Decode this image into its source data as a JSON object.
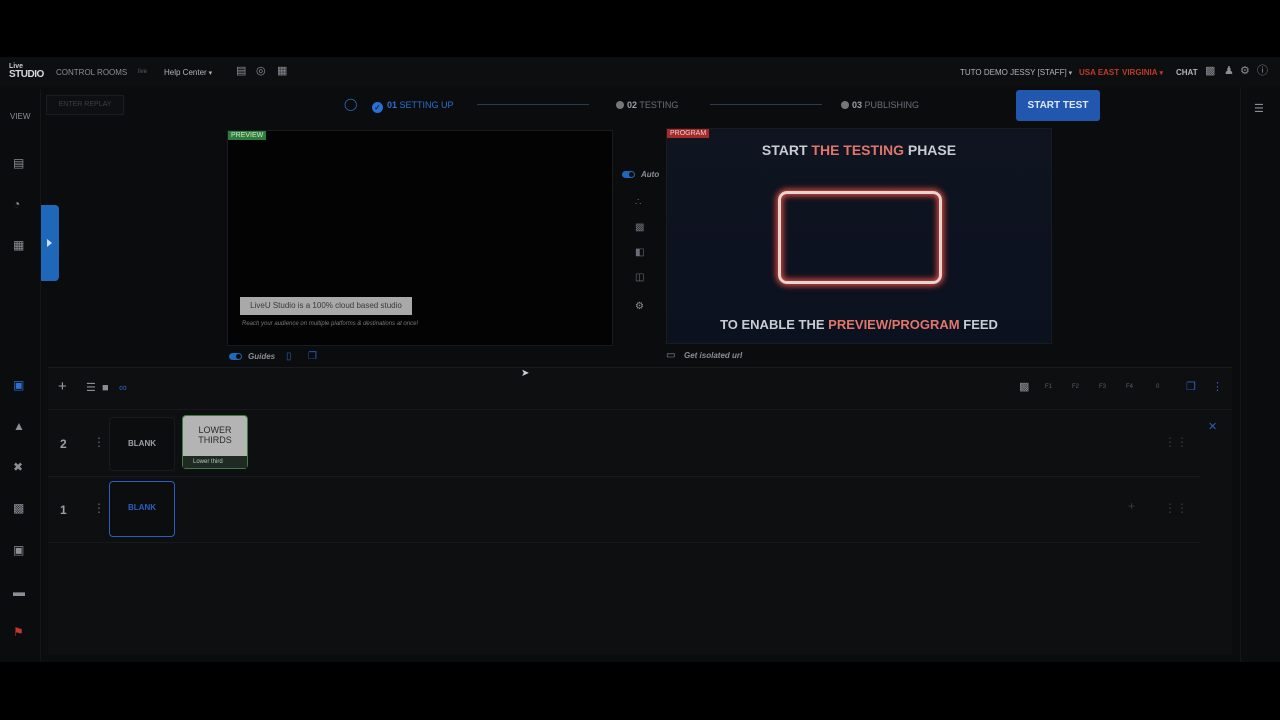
{
  "app": {
    "logo_top": "Live",
    "logo_bottom": "STUDIO",
    "nav": {
      "control_rooms": "CONTROL ROOMS",
      "badge": "live",
      "help_center": "Help Center",
      "user": "TUTO DEMO JESSY [STAFF]",
      "region": "USA EAST",
      "region_city": "VIRGINIA",
      "chat": "CHAT"
    }
  },
  "left_rail": {
    "view_label": "VIEW"
  },
  "toolbar": {
    "enter_replay": "ENTER REPLAY",
    "start_test": "START TEST"
  },
  "stepper": {
    "steps": [
      {
        "num": "01",
        "label": "SETTING UP"
      },
      {
        "num": "02",
        "label": "TESTING"
      },
      {
        "num": "03",
        "label": "PUBLISHING"
      }
    ]
  },
  "preview": {
    "tag": "PREVIEW",
    "lower_third_main": "LiveU Studio is a 100% cloud based studio",
    "lower_third_sub": "Reach your audience on multiple platforms & destinations at once!",
    "guides_label": "Guides"
  },
  "mid_controls": {
    "auto_label": "Auto"
  },
  "program": {
    "tag": "PROGRAM",
    "title_pre": "START ",
    "title_hl": "THE TESTING",
    "title_post": " PHASE",
    "foot_pre": "TO ENABLE THE ",
    "foot_hl": "PREVIEW/PROGRAM",
    "foot_post": " FEED",
    "isolated_url": "Get isolated url"
  },
  "layers": {
    "bar_right": [
      "F1",
      "F2",
      "F3",
      "F4",
      "0"
    ],
    "rows": [
      {
        "num": "2",
        "tiles": [
          {
            "label": "BLANK"
          },
          {
            "label": "LOWER THIRDS",
            "caption": "Lower third"
          }
        ]
      },
      {
        "num": "1",
        "tiles": [
          {
            "label": "BLANK"
          }
        ]
      }
    ]
  },
  "colors": {
    "accent": "#2b6fd1",
    "preview_tag": "#2e7d3b",
    "program_tag": "#a52a2a",
    "highlight": "#e0766a"
  }
}
